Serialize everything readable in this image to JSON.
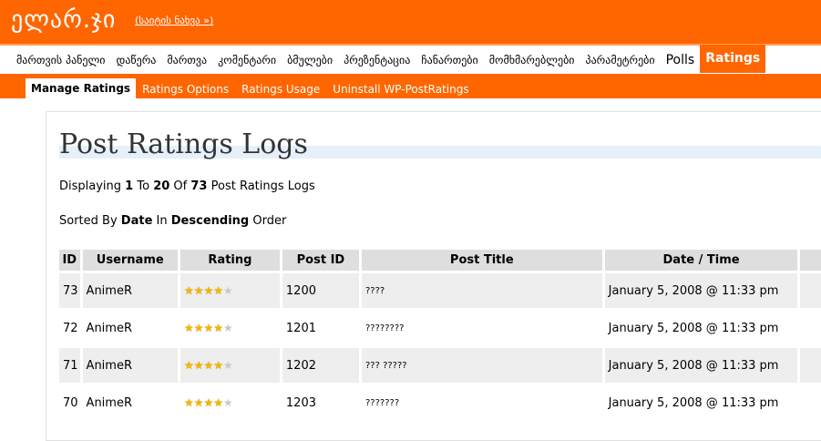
{
  "header": {
    "site_title": "ელარ.ჯი",
    "visit_site": "(საიტის ნახვა »)"
  },
  "main_nav": [
    "მართვის პანელი",
    "დაწერა",
    "მართვა",
    "კომენტარი",
    "ბმულები",
    "პრეზენტაცია",
    "ჩანართები",
    "მომხმარებლები",
    "პარამეტრები",
    "Polls",
    "Ratings"
  ],
  "sub_nav": [
    "Manage Ratings",
    "Ratings Options",
    "Ratings Usage",
    "Uninstall WP-PostRatings"
  ],
  "page": {
    "title": "Post Ratings Logs",
    "displaying": {
      "prefix": "Displaying",
      "from": "1",
      "to_word": "To",
      "to": "20",
      "of_word": "Of",
      "total": "73",
      "suffix": "Post Ratings Logs"
    },
    "sorted": {
      "prefix": "Sorted By",
      "field": "Date",
      "in_word": "In",
      "order": "Descending",
      "suffix": "Order"
    }
  },
  "table": {
    "headers": [
      "ID",
      "Username",
      "Rating",
      "Post ID",
      "Post Title",
      "Date / Time"
    ],
    "rows": [
      {
        "id": "73",
        "username": "AnimeR",
        "rating": 4,
        "post_id": "1200",
        "post_title": "????",
        "datetime": "January 5, 2008 @ 11:33 pm"
      },
      {
        "id": "72",
        "username": "AnimeR",
        "rating": 4,
        "post_id": "1201",
        "post_title": "????????",
        "datetime": "January 5, 2008 @ 11:33 pm"
      },
      {
        "id": "71",
        "username": "AnimeR",
        "rating": 4,
        "post_id": "1202",
        "post_title": "??? ?????",
        "datetime": "January 5, 2008 @ 11:33 pm"
      },
      {
        "id": "70",
        "username": "AnimeR",
        "rating": 4,
        "post_id": "1203",
        "post_title": "???????",
        "datetime": "January 5, 2008 @ 11:33 pm"
      }
    ],
    "rating_max": 5
  },
  "colors": {
    "brand_orange": "#ff6600",
    "star_full": "#f2b705",
    "star_empty": "#c8c8c8"
  }
}
